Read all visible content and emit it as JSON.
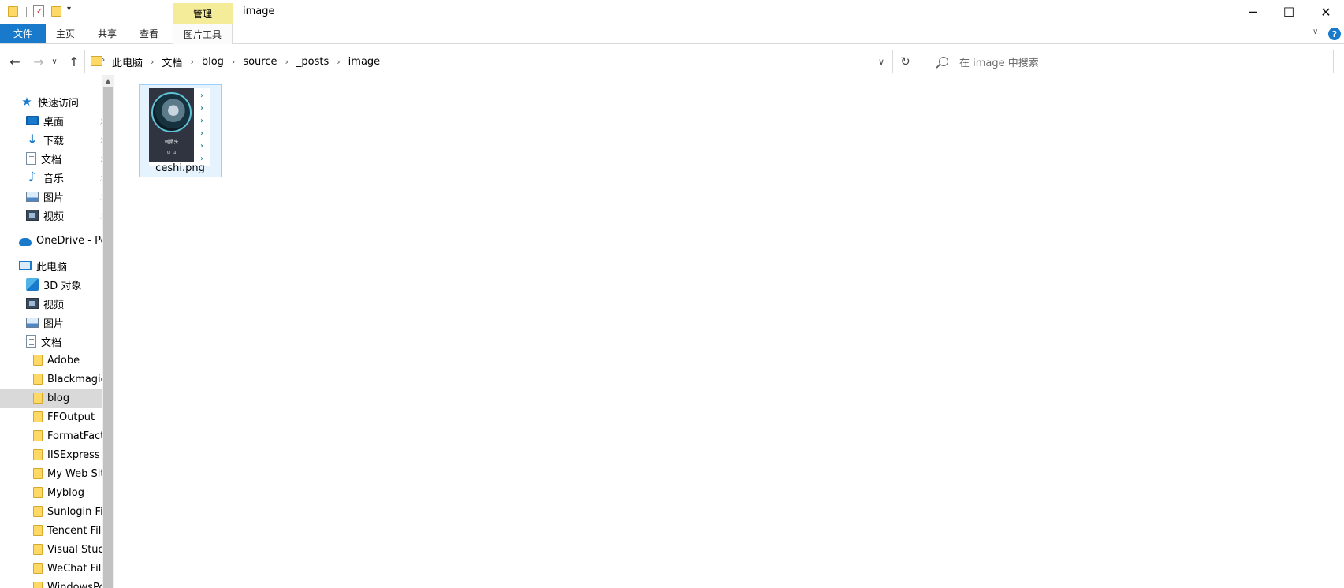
{
  "window": {
    "title": "image",
    "contextual_tab_group": "管理",
    "minimize_icon": "─",
    "maximize_icon": "☐",
    "close_icon": "✕"
  },
  "ribbon": {
    "tabs": [
      {
        "label": "文件"
      },
      {
        "label": "主页"
      },
      {
        "label": "共享"
      },
      {
        "label": "查看"
      },
      {
        "label": "图片工具"
      }
    ],
    "help_label": "?"
  },
  "address_bar": {
    "path": [
      "此电脑",
      "文档",
      "blog",
      "source",
      "_posts",
      "image"
    ]
  },
  "search": {
    "placeholder": "在 image 中搜索"
  },
  "nav_pane": {
    "quick_access": {
      "label": "快速访问",
      "items": [
        {
          "label": "桌面",
          "icon": "desktop-icon",
          "pinned": true
        },
        {
          "label": "下载",
          "icon": "download-icon",
          "pinned": true
        },
        {
          "label": "文档",
          "icon": "documents-icon",
          "pinned": true
        },
        {
          "label": "音乐",
          "icon": "music-icon",
          "pinned": true
        },
        {
          "label": "图片",
          "icon": "pictures-icon",
          "pinned": true
        },
        {
          "label": "视频",
          "icon": "videos-icon",
          "pinned": true
        }
      ]
    },
    "onedrive": {
      "label": "OneDrive - Perso"
    },
    "this_pc": {
      "label": "此电脑",
      "items": [
        {
          "label": "3D 对象",
          "icon": "3d-objects-icon"
        },
        {
          "label": "视频",
          "icon": "videos-icon"
        },
        {
          "label": "图片",
          "icon": "pictures-icon"
        },
        {
          "label": "文档",
          "icon": "documents-icon"
        }
      ],
      "document_folders": [
        {
          "label": "Adobe"
        },
        {
          "label": "Blackmagic D"
        },
        {
          "label": "blog",
          "selected": true
        },
        {
          "label": "FFOutput"
        },
        {
          "label": "FormatFactory"
        },
        {
          "label": "IISExpress"
        },
        {
          "label": "My Web Sites"
        },
        {
          "label": "Myblog"
        },
        {
          "label": "Sunlogin Files"
        },
        {
          "label": "Tencent Files"
        },
        {
          "label": "Visual Studio"
        },
        {
          "label": "WeChat Files"
        },
        {
          "label": "WindowsPow"
        }
      ]
    }
  },
  "content": {
    "files": [
      {
        "name": "ceshi.png",
        "thumbnail_caption": "刺猬头",
        "thumbnail_icons": "⊙ ⊡"
      }
    ]
  },
  "colors": {
    "file_tab": "#1979ca",
    "manage_tab": "#f5ec9a",
    "selection_bg": "#e5f3ff",
    "selection_border": "#99d1ff",
    "nav_selected": "#d9d9d9"
  }
}
